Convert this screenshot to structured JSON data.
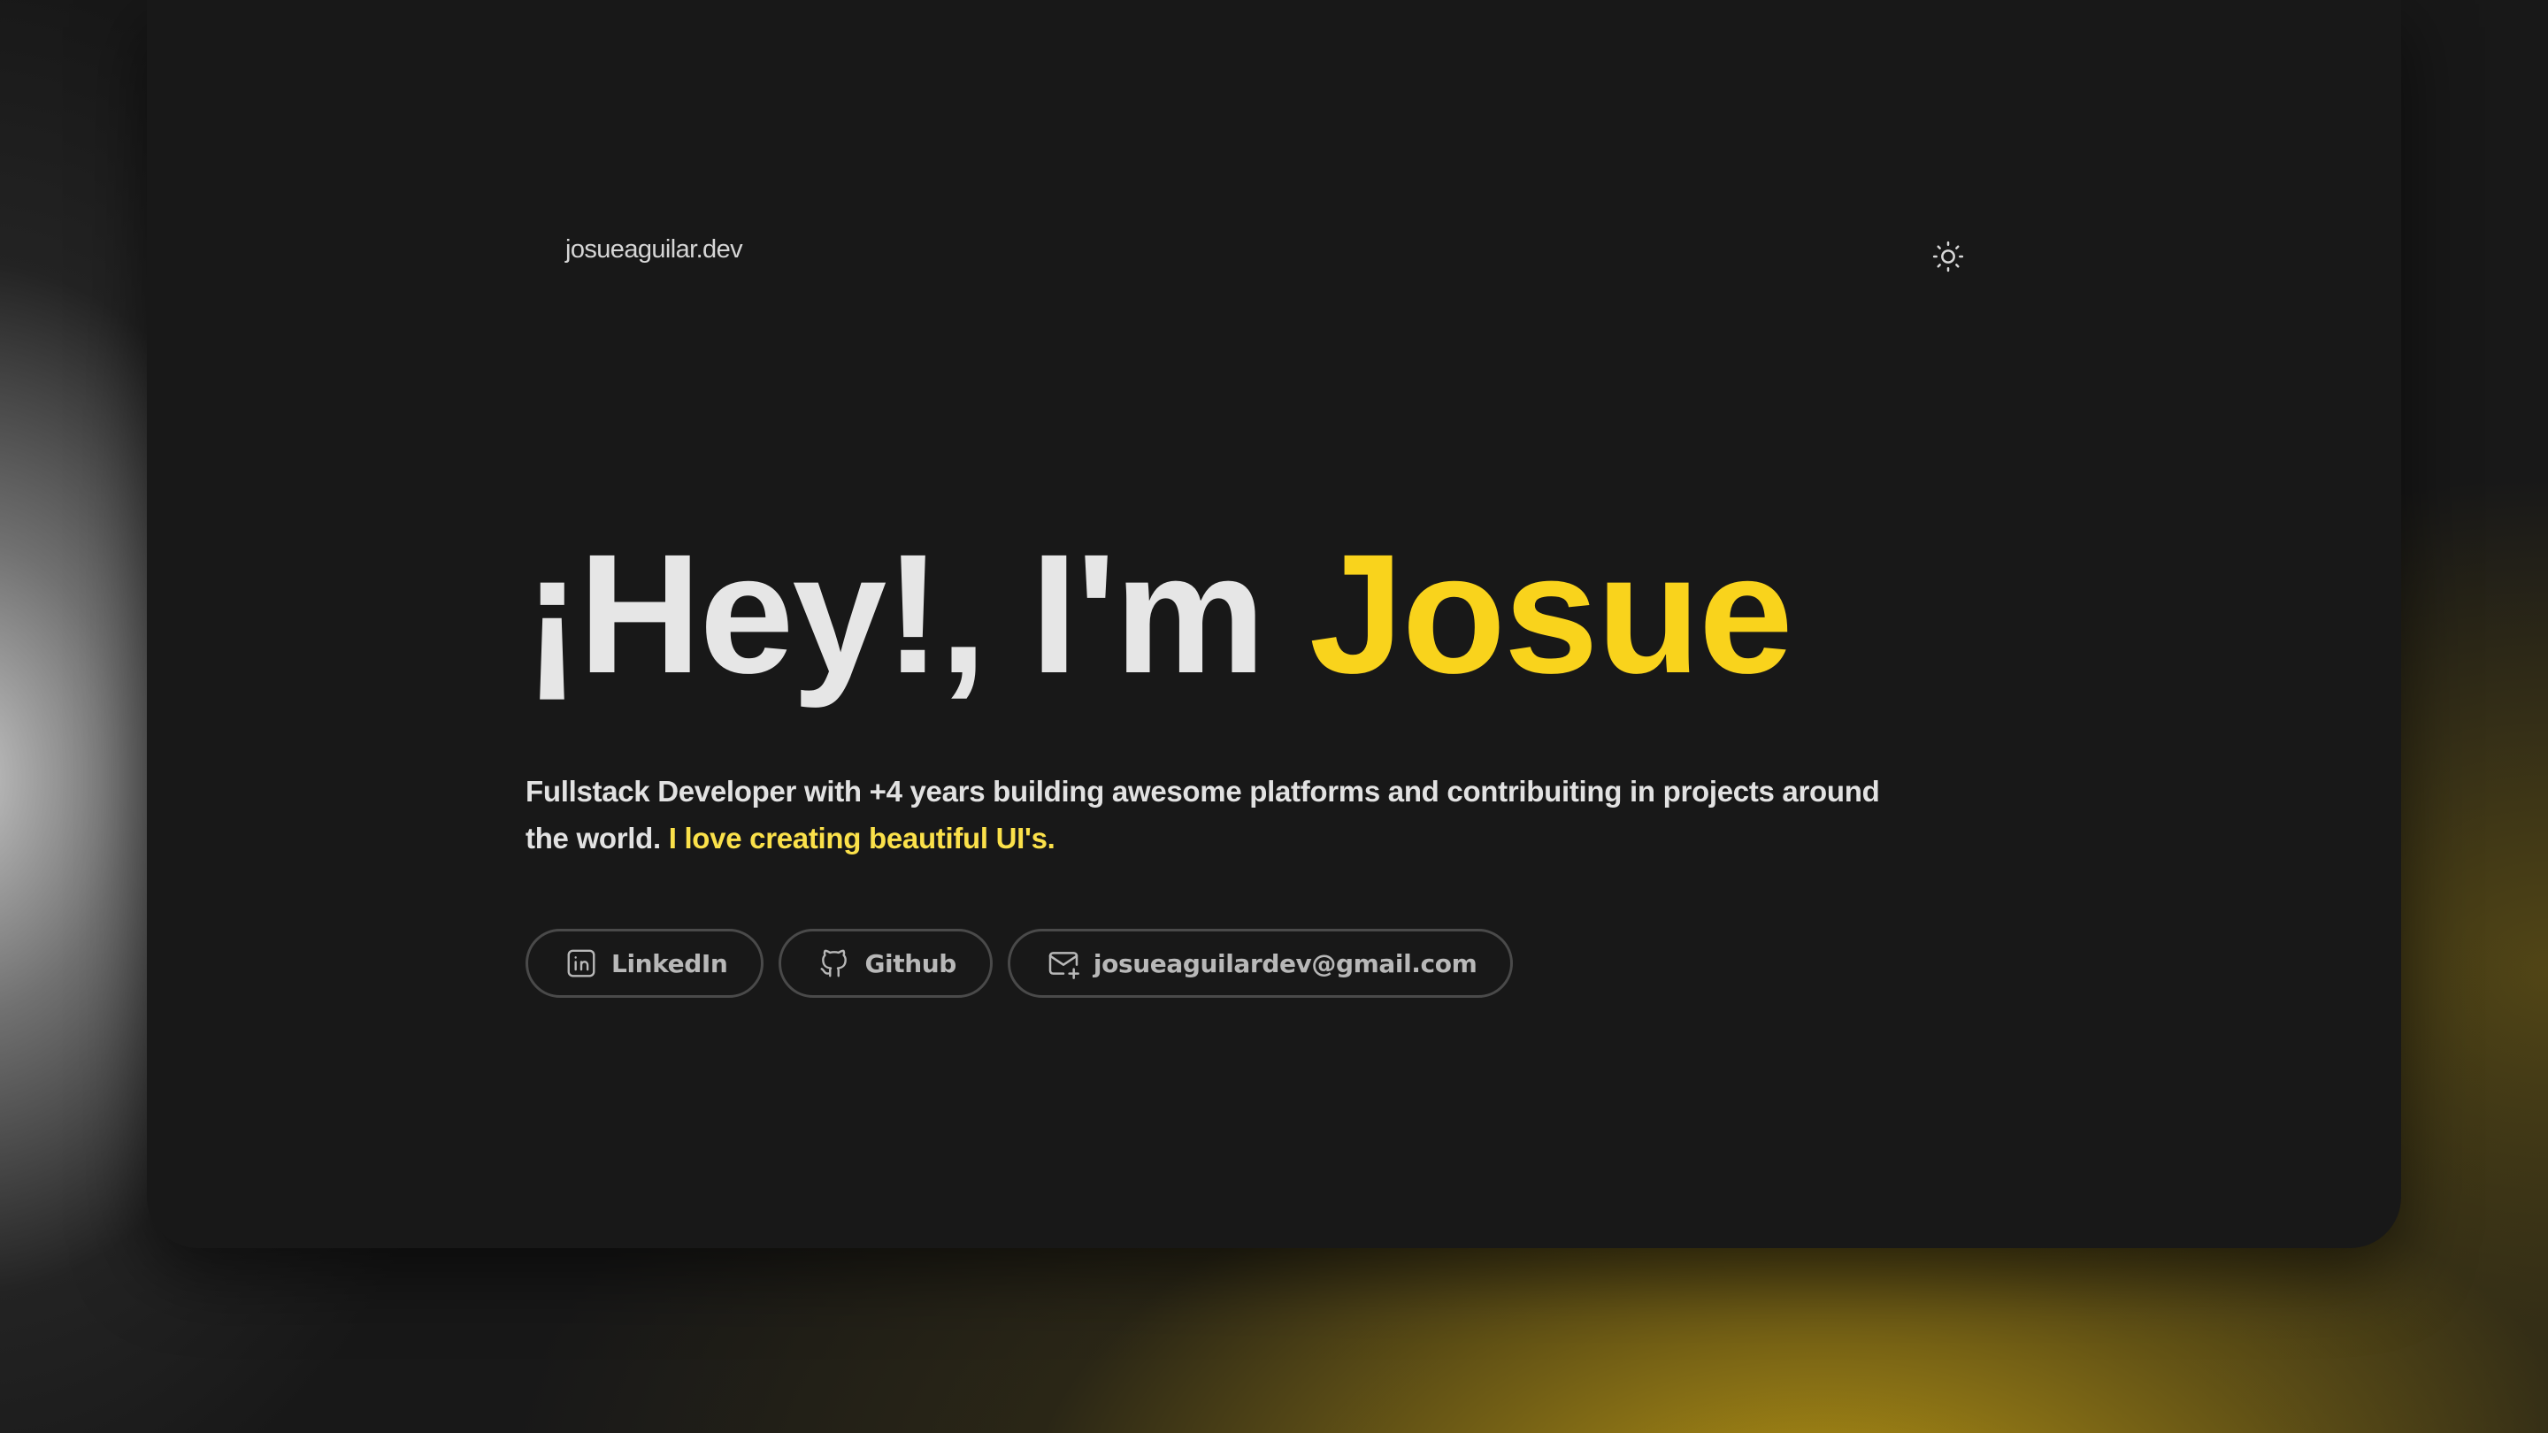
{
  "header": {
    "site_title": "josueaguilar.dev",
    "theme_toggle_icon": "sun-icon"
  },
  "hero": {
    "greeting": "¡Hey!, I'm ",
    "name": "Josue",
    "bio_main": "Fullstack Developer with +4 years building awesome platforms and contribuiting in projects around the world. ",
    "bio_highlight": "I love creating beautiful UI's."
  },
  "links": [
    {
      "label": "LinkedIn",
      "icon": "linkedin-icon"
    },
    {
      "label": "Github",
      "icon": "github-icon"
    },
    {
      "label": "josueaguilardev@gmail.com",
      "icon": "mail-icon"
    }
  ],
  "colors": {
    "background": "#181818",
    "accent": "#f9d31c",
    "text": "#e6e6e6",
    "muted": "#b8b8b8"
  }
}
